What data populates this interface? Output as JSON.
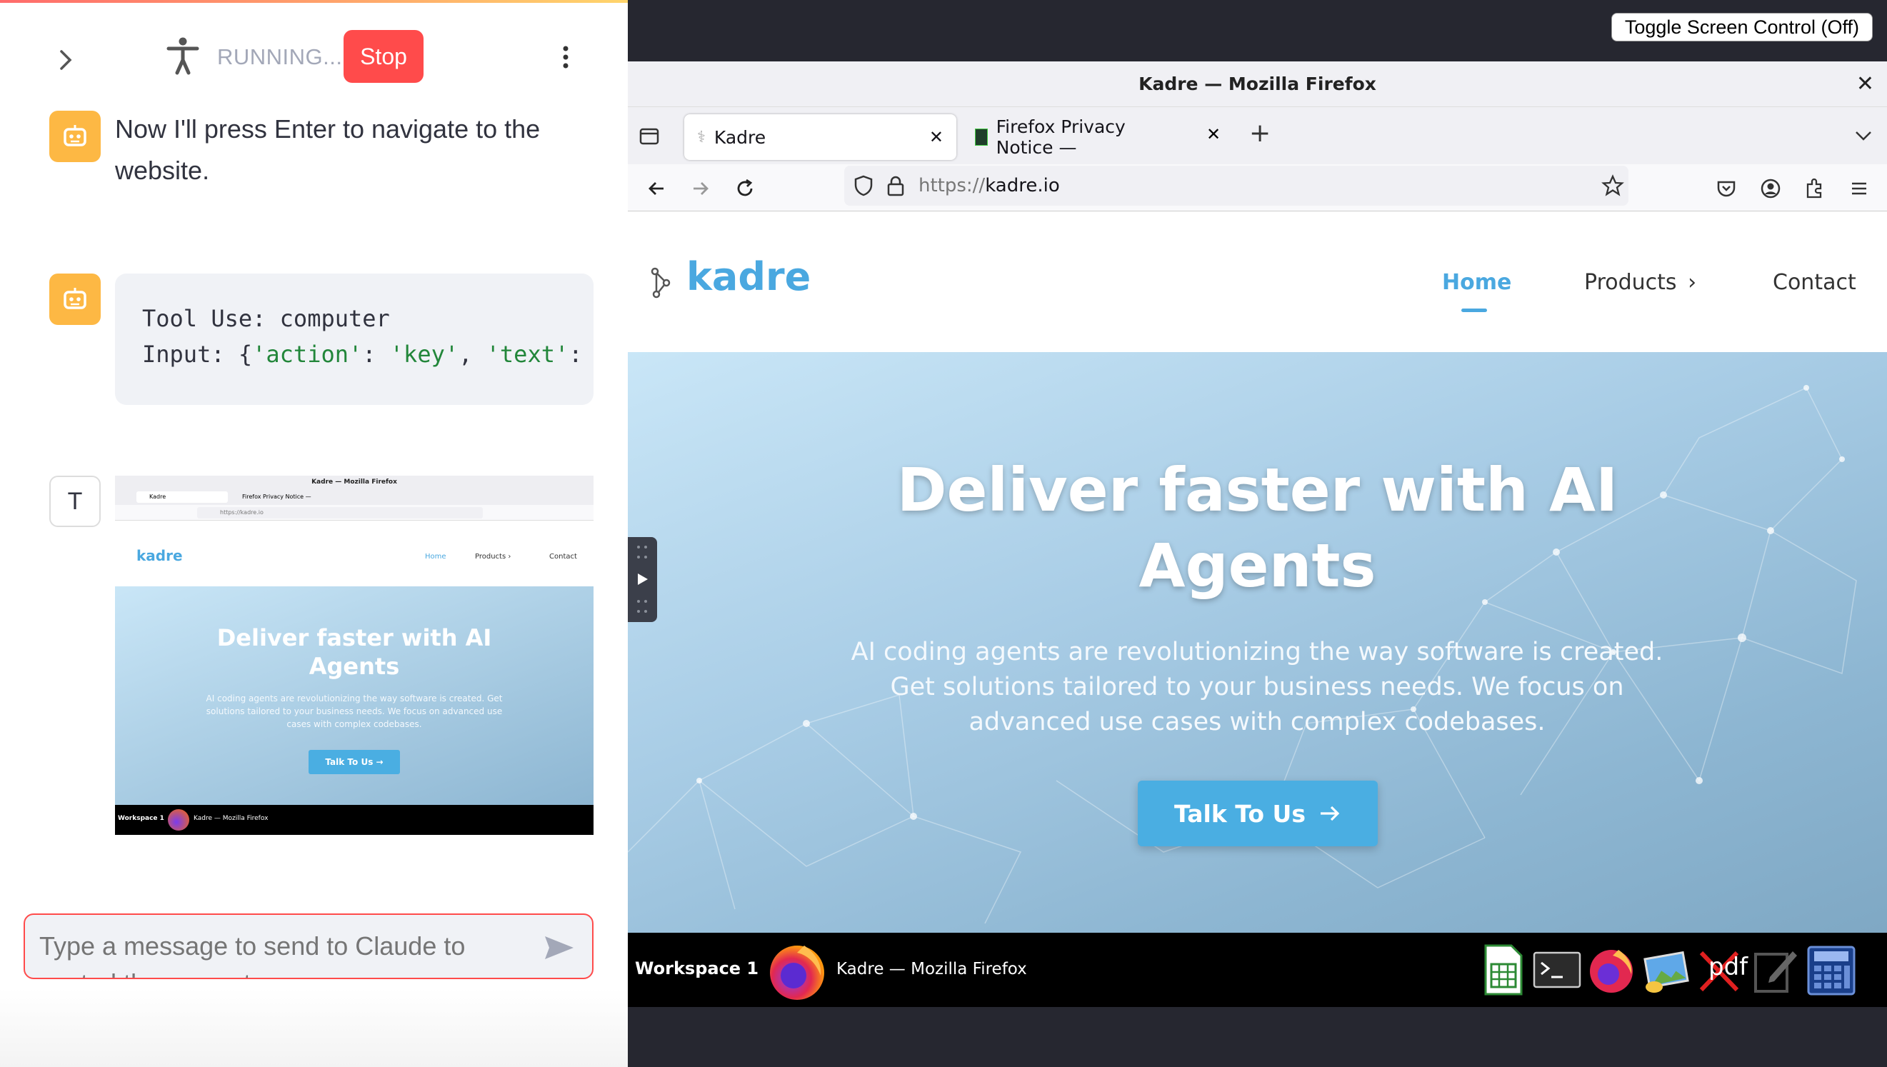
{
  "left_panel": {
    "status_text": "RUNNING...",
    "stop_label": "Stop",
    "messages": {
      "assistant_text": "Now I'll press Enter to navigate to the website.",
      "tool_line1": "Tool Use: computer",
      "tool_line2_prefix": "Input: {",
      "tool_line2_key1": "'action'",
      "tool_line2_sep1": ": ",
      "tool_line2_val1": "'key'",
      "tool_line2_sep2": ", ",
      "tool_line2_key2": "'text'",
      "tool_line2_sep3": ":",
      "user_avatar_letter": "T"
    },
    "thumbnail": {
      "window_title": "Kadre — Mozilla Firefox",
      "tab1": "Kadre",
      "tab2": "Firefox Privacy Notice —",
      "url": "https://kadre.io",
      "logo": "kadre",
      "nav": [
        "Home",
        "Products ›",
        "Contact"
      ],
      "hero_title": "Deliver faster with AI Agents",
      "hero_text": "AI coding agents are revolutionizing the way software is created. Get solutions tailored to your business needs. We focus on advanced use cases with complex codebases.",
      "cta": "Talk To Us →",
      "workspace": "Workspace 1",
      "taskbar_title": "Kadre — Mozilla Firefox"
    },
    "chat_placeholder": "Type a message to send to Claude to control the computer..."
  },
  "right_panel": {
    "toggle_label": "Toggle Screen Control (Off)",
    "firefox": {
      "window_title": "Kadre — Mozilla Firefox",
      "tabs": [
        {
          "label": "Kadre"
        },
        {
          "label": "Firefox Privacy Notice —"
        }
      ],
      "url_scheme": "https://",
      "url_host": "kadre.io"
    },
    "site": {
      "logo": "kadre",
      "nav": {
        "home": "Home",
        "products": "Products",
        "contact": "Contact"
      },
      "hero_title_line1": "Deliver faster with AI",
      "hero_title_line2": "Agents",
      "hero_text_line1": "AI coding agents are revolutionizing the way software is created.",
      "hero_text_line2": "Get solutions tailored to your business needs. We focus on",
      "hero_text_line3": "advanced use cases with complex codebases.",
      "cta_label": "Talk To Us"
    },
    "taskbar": {
      "workspace": "Workspace 1",
      "window_title": "Kadre — Mozilla Firefox",
      "pdf_label": "pdf"
    }
  },
  "colors": {
    "accent_red": "#ff4b4b",
    "avatar_yellow": "#fdb844",
    "brand_blue": "#4aa8e0",
    "code_green": "#22863a"
  }
}
